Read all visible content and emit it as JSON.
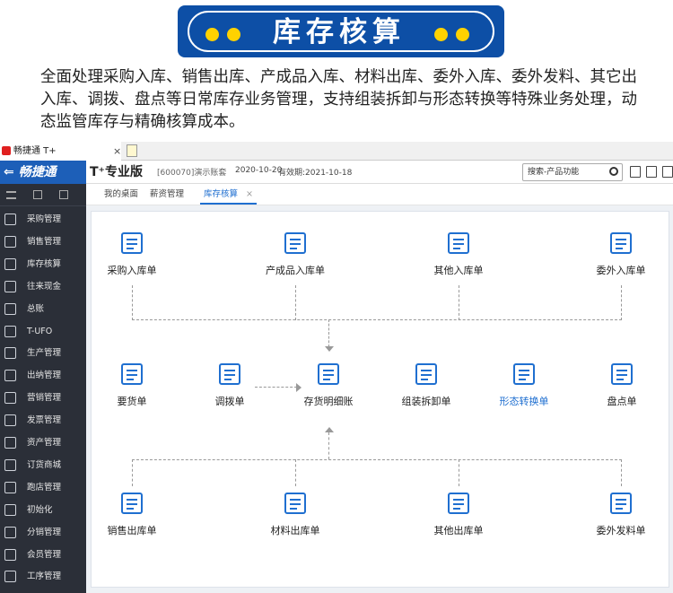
{
  "banner": {
    "title": "库存核算"
  },
  "description": "全面处理采购入库、销售出库、产成品入库、材料出库、委外入库、委外发料、其它出入库、调拨、盘点等日常库存业务管理，支持组装拆卸与形态转换等特殊业务处理，动态监管库存与精确核算成本。",
  "window": {
    "tab_title": "畅捷通 T+",
    "tab_close": "×"
  },
  "header": {
    "brand": "⇐ 畅捷通",
    "product": "T⁺专业版",
    "account": "[600070]演示账套",
    "date": "2020-10-20",
    "valid_until": "有效期:2021-10-18",
    "search_placeholder": "搜索-产品功能"
  },
  "sidebar": {
    "items": [
      {
        "label": "采购管理"
      },
      {
        "label": "销售管理"
      },
      {
        "label": "库存核算"
      },
      {
        "label": "往来现金"
      },
      {
        "label": "总账"
      },
      {
        "label": "T-UFO"
      },
      {
        "label": "生产管理"
      },
      {
        "label": "出纳管理"
      },
      {
        "label": "营销管理"
      },
      {
        "label": "发票管理"
      },
      {
        "label": "资产管理"
      },
      {
        "label": "订货商城"
      },
      {
        "label": "跑店管理"
      },
      {
        "label": "初始化"
      },
      {
        "label": "分销管理"
      },
      {
        "label": "会员管理"
      },
      {
        "label": "工序管理"
      }
    ]
  },
  "subtabs": [
    {
      "label": "我的桌面"
    },
    {
      "label": "薪资管理"
    },
    {
      "label": "库存核算",
      "close": "×"
    }
  ],
  "flow": {
    "top": [
      {
        "label": "采购入库单",
        "icon": "warehouse-in-icon"
      },
      {
        "label": "产成品入库单",
        "icon": "boxes-icon"
      },
      {
        "label": "其他入库单",
        "icon": "basket-in-icon"
      },
      {
        "label": "委外入库单",
        "icon": "outsource-in-icon"
      }
    ],
    "middle": [
      {
        "label": "要货单",
        "icon": "scroll-icon"
      },
      {
        "label": "调拨单",
        "icon": "transfer-icon"
      },
      {
        "label": "存货明细账",
        "icon": "ledger-icon"
      },
      {
        "label": "组装拆卸单",
        "icon": "assemble-icon"
      },
      {
        "label": "形态转换单",
        "icon": "convert-icon"
      },
      {
        "label": "盘点单",
        "icon": "inventory-check-icon"
      }
    ],
    "bottom": [
      {
        "label": "销售出库单",
        "icon": "tray-out-icon"
      },
      {
        "label": "材料出库单",
        "icon": "material-out-icon"
      },
      {
        "label": "其他出库单",
        "icon": "basket-out-icon"
      },
      {
        "label": "委外发料单",
        "icon": "forklift-icon"
      }
    ]
  },
  "colors": {
    "accent": "#1f6fd0",
    "banner": "#0d4fa6",
    "sidebar": "#2b2f38",
    "dot": "#ffd200"
  }
}
